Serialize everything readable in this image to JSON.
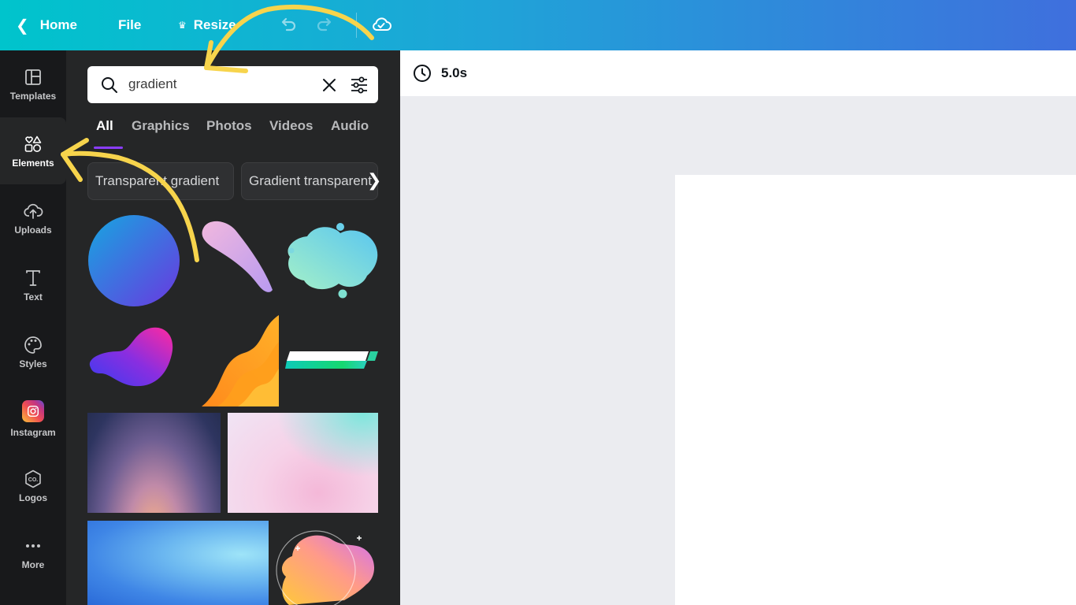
{
  "topbar": {
    "home_label": "Home",
    "file_label": "File",
    "resize_label": "Resize"
  },
  "rail": {
    "items": [
      {
        "label": "Templates",
        "icon": "templates-icon"
      },
      {
        "label": "Elements",
        "icon": "elements-icon",
        "active": true
      },
      {
        "label": "Uploads",
        "icon": "upload-cloud-icon"
      },
      {
        "label": "Text",
        "icon": "text-icon"
      },
      {
        "label": "Styles",
        "icon": "palette-icon"
      },
      {
        "label": "Instagram",
        "icon": "instagram-icon"
      },
      {
        "label": "Logos",
        "icon": "logos-icon"
      },
      {
        "label": "More",
        "icon": "more-dots-icon"
      }
    ]
  },
  "panel": {
    "search": {
      "value": "gradient"
    },
    "tabs": [
      {
        "label": "All",
        "active": true
      },
      {
        "label": "Graphics"
      },
      {
        "label": "Photos"
      },
      {
        "label": "Videos"
      },
      {
        "label": "Audio"
      }
    ],
    "suggestions": [
      "Transparent gradient",
      "Gradient transparent"
    ]
  },
  "canvas": {
    "duration_label": "5.0s"
  },
  "colors": {
    "topbar_start": "#00c4cc",
    "topbar_end": "#3f6fdd",
    "panel_bg": "#252627",
    "rail_bg": "#18191b",
    "accent": "#8b3dff",
    "annotation": "#f7d44c"
  }
}
